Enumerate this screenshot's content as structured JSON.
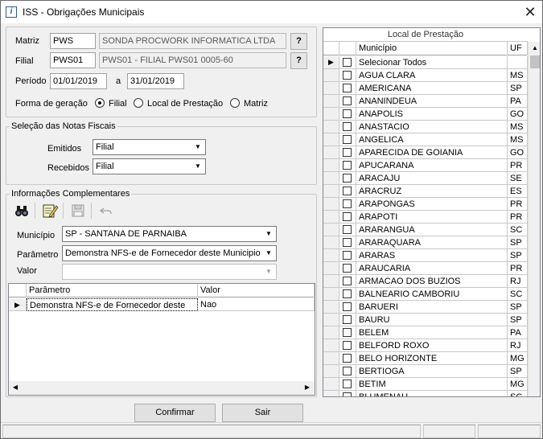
{
  "window": {
    "title": "ISS - Obrigações Municipais"
  },
  "header": {
    "matriz_label": "Matriz",
    "matriz_code": "PWS",
    "matriz_name": "SONDA PROCWORK INFORMATICA LTDA",
    "filial_label": "Filial",
    "filial_code": "PWS01",
    "filial_name": "PWS01 - FILIAL PWS01 0005-60",
    "periodo_label": "Período",
    "periodo_inicio": "01/01/2019",
    "periodo_sep": "a",
    "periodo_fim": "31/01/2019",
    "help_label": "?",
    "forma_label": "Forma de geração",
    "forma_options": [
      "Filial",
      "Local de Prestação",
      "Matriz"
    ],
    "forma_selected": "Filial"
  },
  "selecao": {
    "title": "Seleção das Notas Fiscais",
    "emitidos_label": "Emitidos",
    "emitidos_value": "Filial",
    "recebidos_label": "Recebidos",
    "recebidos_value": "Filial"
  },
  "complementares": {
    "title": "Informações Complementares",
    "toolbar_icons": [
      "binoculars-icon",
      "edit-icon",
      "save-icon",
      "undo-icon"
    ],
    "municipio_label": "Município",
    "municipio_value": "SP - SANTANA DE PARNAIBA",
    "parametro_label": "Parâmetro",
    "parametro_value": "Demonstra NFS-e de Fornecedor deste Municipio",
    "valor_label": "Valor",
    "valor_value": "",
    "grid_columns": [
      "Parâmetro",
      "Valor"
    ],
    "grid_rows": [
      {
        "parametro": "Demonstra NFS-e de Fornecedor deste",
        "valor": "Nao"
      }
    ]
  },
  "local_prestacao": {
    "title": "Local de Prestação",
    "columns": [
      "Município",
      "UF"
    ],
    "rows": [
      {
        "municipio": "Selecionar Todos",
        "uf": ""
      },
      {
        "municipio": "AGUA CLARA",
        "uf": "MS"
      },
      {
        "municipio": "AMERICANA",
        "uf": "SP"
      },
      {
        "municipio": "ANANINDEUA",
        "uf": "PA"
      },
      {
        "municipio": "ANAPOLIS",
        "uf": "GO"
      },
      {
        "municipio": "ANASTACIO",
        "uf": "MS"
      },
      {
        "municipio": "ANGELICA",
        "uf": "MS"
      },
      {
        "municipio": "APARECIDA DE GOIANIA",
        "uf": "GO"
      },
      {
        "municipio": "APUCARANA",
        "uf": "PR"
      },
      {
        "municipio": "ARACAJU",
        "uf": "SE"
      },
      {
        "municipio": "ARACRUZ",
        "uf": "ES"
      },
      {
        "municipio": "ARAPONGAS",
        "uf": "PR"
      },
      {
        "municipio": "ARAPOTI",
        "uf": "PR"
      },
      {
        "municipio": "ARARANGUA",
        "uf": "SC"
      },
      {
        "municipio": "ARARAQUARA",
        "uf": "SP"
      },
      {
        "municipio": "ARARAS",
        "uf": "SP"
      },
      {
        "municipio": "ARAUCARIA",
        "uf": "PR"
      },
      {
        "municipio": "ARMACAO DOS BUZIOS",
        "uf": "RJ"
      },
      {
        "municipio": "BALNEARIO CAMBORIU",
        "uf": "SC"
      },
      {
        "municipio": "BARUERI",
        "uf": "SP"
      },
      {
        "municipio": "BAURU",
        "uf": "SP"
      },
      {
        "municipio": "BELEM",
        "uf": "PA"
      },
      {
        "municipio": "BELFORD ROXO",
        "uf": "RJ"
      },
      {
        "municipio": "BELO HORIZONTE",
        "uf": "MG"
      },
      {
        "municipio": "BERTIOGA",
        "uf": "SP"
      },
      {
        "municipio": "BETIM",
        "uf": "MG"
      },
      {
        "municipio": "BLUMENAU",
        "uf": "SC"
      }
    ]
  },
  "footer": {
    "confirmar_label": "Confirmar",
    "sair_label": "Sair"
  }
}
